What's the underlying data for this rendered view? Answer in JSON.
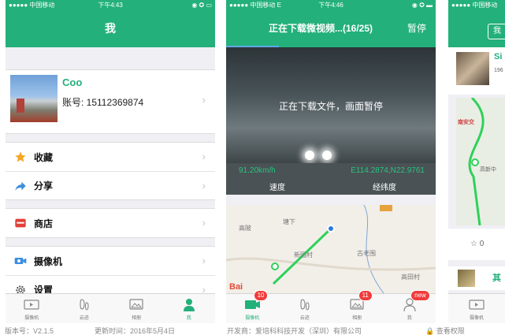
{
  "colors": {
    "brand_green": "#23b07a",
    "badge_red": "#f03b3b"
  },
  "phone1": {
    "status": {
      "carrier": "●●●●● 中国移动 ",
      "time": "下午4:43",
      "right": "◉ ✪ ▭"
    },
    "title": "我",
    "profile": {
      "name": "Coo",
      "account": "账号: 15112369874"
    },
    "menu_group1": [
      {
        "label": "收藏",
        "icon": "star-icon"
      },
      {
        "label": "分享",
        "icon": "share-arrow-icon"
      }
    ],
    "menu_group2": [
      {
        "label": "商店",
        "icon": "store-icon"
      }
    ],
    "menu_group3": [
      {
        "label": "摄像机",
        "icon": "camera-icon"
      },
      {
        "label": "设置",
        "icon": "gear-icon"
      }
    ],
    "tabs": [
      {
        "label": "摄像机"
      },
      {
        "label": "云迹"
      },
      {
        "label": "相册"
      },
      {
        "label": "我"
      }
    ]
  },
  "phone2": {
    "status": {
      "carrier": "●●●●● 中国移动 E",
      "time": "下午4:46",
      "right": "◉ ✪ ▬"
    },
    "title": "正在下载微视频...(16/25)",
    "pause_label": "暂停",
    "download_progress": 0.25,
    "video_message": "正在下载文件，画面暂停",
    "speed_value": "91.20km/h",
    "coords_value": "E114.2874,N22.9761",
    "speed_label": "速度",
    "coords_label": "经纬度",
    "map_labels": [
      "高陂",
      "塘下",
      "新园村",
      "古老围",
      "高田村"
    ],
    "baidu_text": "Bai",
    "tabs": [
      {
        "label": "摄像机",
        "badge": "10"
      },
      {
        "label": "云迹",
        "badge": ""
      },
      {
        "label": "相册",
        "badge": "11"
      },
      {
        "label": "我",
        "badge": "new"
      }
    ]
  },
  "phone3": {
    "status": {
      "carrier": "●●●●● 中国移动"
    },
    "nav_button": "我",
    "card_name": "Si",
    "card_sub": "196",
    "map_labels": [
      "南安交",
      "高新中"
    ],
    "likes": "☆ 0",
    "second_name": "其",
    "tab_label": "摄像机"
  },
  "captions": {
    "version": "版本号：V2.1.5",
    "updated": "更新时间：2016年5月4日",
    "developer": "开发商：爱培科科技开发（深圳）有限公司",
    "permissions": "查看权限"
  }
}
